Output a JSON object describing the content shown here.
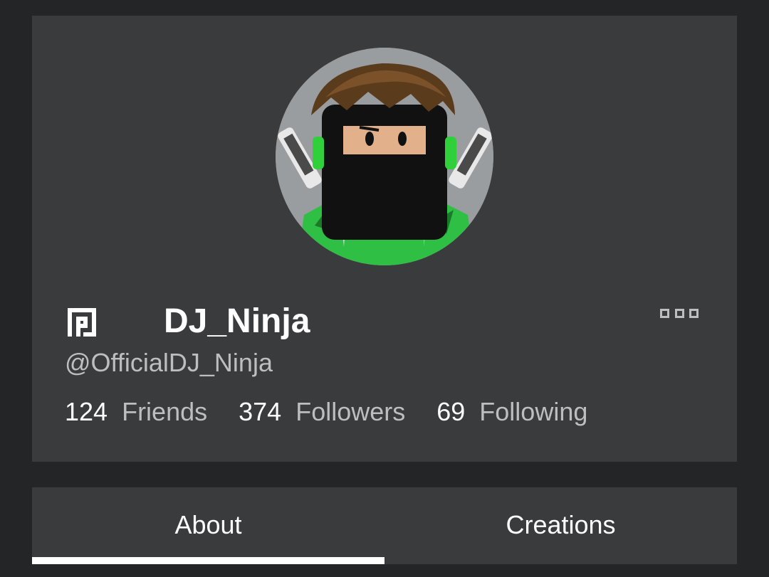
{
  "profile": {
    "display_name": "DJ_Ninja",
    "username": "@OfficialDJ_Ninja",
    "badge_icon": "premium-icon",
    "more_icon": "more-icon",
    "stats": [
      {
        "count": "124",
        "label": "Friends"
      },
      {
        "count": "374",
        "label": "Followers"
      },
      {
        "count": "69",
        "label": "Following"
      }
    ]
  },
  "tabs": [
    {
      "label": "About",
      "active": true
    },
    {
      "label": "Creations",
      "active": false
    }
  ],
  "colors": {
    "page_background": "#232527",
    "card_background": "#393b3d",
    "primary_text": "#ffffff",
    "secondary_text": "#bdbebe",
    "avatar_green": "#2ecc40"
  }
}
